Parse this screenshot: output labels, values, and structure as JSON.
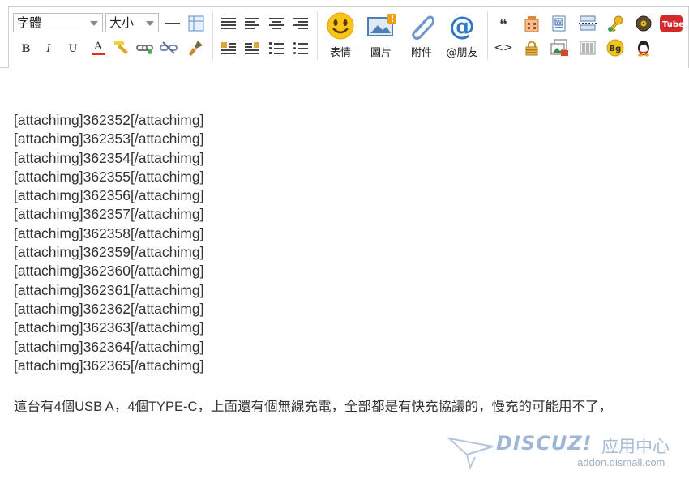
{
  "toolbar": {
    "font_select": "字體",
    "size_select": "大小",
    "bold": "B",
    "italic": "I",
    "underline": "U",
    "font_color": "A",
    "emoticon_label": "表情",
    "image_label": "圖片",
    "attach_label": "附件",
    "mention_label": "@朋友",
    "quote_glyph": "❝",
    "code_glyph": "<>",
    "bg_glyph": "Bg",
    "tube_glyph": "Tube"
  },
  "content": {
    "lines": [
      "[attachimg]362352[/attachimg]",
      "[attachimg]362353[/attachimg]",
      "[attachimg]362354[/attachimg]",
      "[attachimg]362355[/attachimg]",
      "[attachimg]362356[/attachimg]",
      "[attachimg]362357[/attachimg]",
      "[attachimg]362358[/attachimg]",
      "[attachimg]362359[/attachimg]",
      "[attachimg]362360[/attachimg]",
      "[attachimg]362361[/attachimg]",
      "[attachimg]362362[/attachimg]",
      "[attachimg]362363[/attachimg]",
      "[attachimg]362364[/attachimg]",
      "[attachimg]362365[/attachimg]"
    ],
    "paragraph": "這台有4個USB A，4個TYPE-C，上面還有個無線充電，全部都是有快充協議的，慢充的可能用不了，"
  },
  "watermark": {
    "logo": "DISCUZ!",
    "cn": "应用中心",
    "url": "addon.dismall.com"
  },
  "colors": {
    "accent": "#2b7bd6",
    "border": "#cfcfcf",
    "text": "#333333",
    "watermark": "#9fb6d6"
  }
}
